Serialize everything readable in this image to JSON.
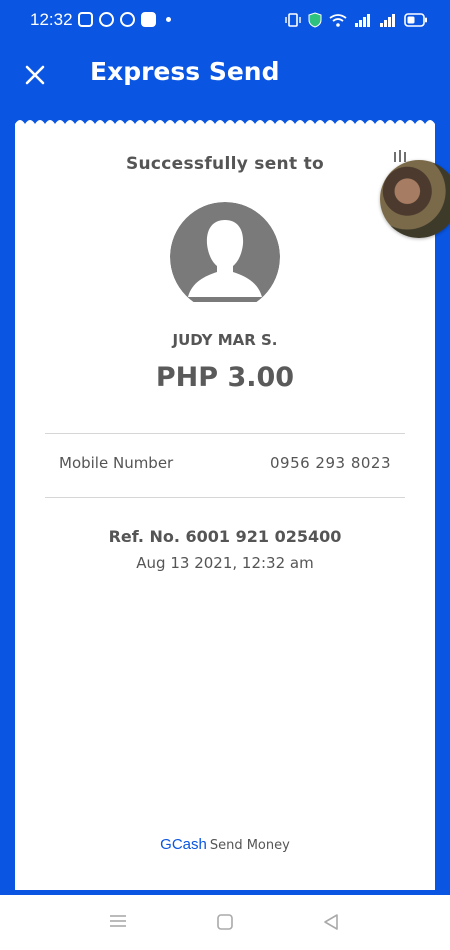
{
  "status_bar": {
    "time": "12:32"
  },
  "header": {
    "title": "Express Send"
  },
  "receipt": {
    "heading": "Successfully sent to",
    "recipient_name": "JUDY MAR S.",
    "amount": "PHP 3.00",
    "mobile_label": "Mobile Number",
    "mobile_value": "0956 293 8023",
    "reference": "Ref. No. 6001 921 025400",
    "date": "Aug 13 2021, 12:32 am",
    "footer_brand": "GCash",
    "footer_sub": "Send Money"
  },
  "colors": {
    "brand_blue": "#0a55e2",
    "text_gray": "#555555"
  },
  "icons": {
    "close": "close-icon",
    "avatar": "avatar-placeholder-icon",
    "nav_menu": "menu-icon",
    "nav_home": "home-icon",
    "nav_back": "back-icon"
  }
}
